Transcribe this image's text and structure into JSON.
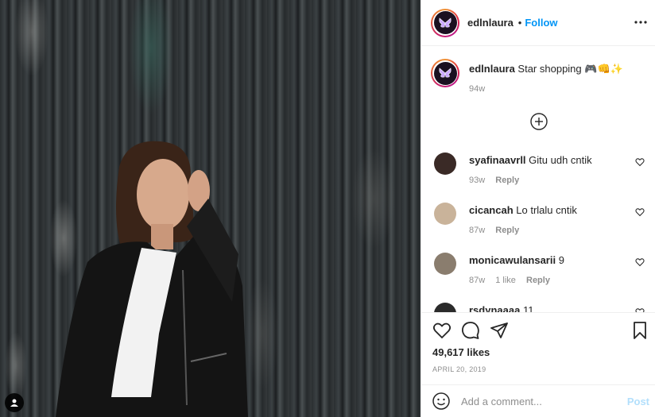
{
  "post": {
    "username": "edlnlaura",
    "follow_label": "Follow",
    "dot": "•",
    "caption_text": "Star shopping 🎮👊✨",
    "caption_time": "94w"
  },
  "comments": [
    {
      "user": "syafinaavrll",
      "text": "Gitu udh cntik",
      "time": "93w",
      "likes": "",
      "reply": "Reply",
      "avatar_color": "#3a2a26"
    },
    {
      "user": "cicancah",
      "text": "Lo trlalu cntik",
      "time": "87w",
      "likes": "",
      "reply": "Reply",
      "avatar_color": "#c9b39a"
    },
    {
      "user": "monicawulansarii",
      "text": "9",
      "time": "87w",
      "likes": "1 like",
      "reply": "Reply",
      "avatar_color": "#8a7d6e"
    },
    {
      "user": "rsdynaaaa",
      "text": "11",
      "time": "",
      "likes": "",
      "reply": "",
      "avatar_color": "#2b2b2b"
    }
  ],
  "actions": {
    "likes": "49,617 likes",
    "date": "APRIL 20, 2019"
  },
  "add_comment": {
    "placeholder": "Add a comment...",
    "post_label": "Post"
  },
  "colors": {
    "accent": "#0095f6",
    "post_disabled": "#b2dffc",
    "muted": "#8e8e8e",
    "text": "#262626"
  }
}
